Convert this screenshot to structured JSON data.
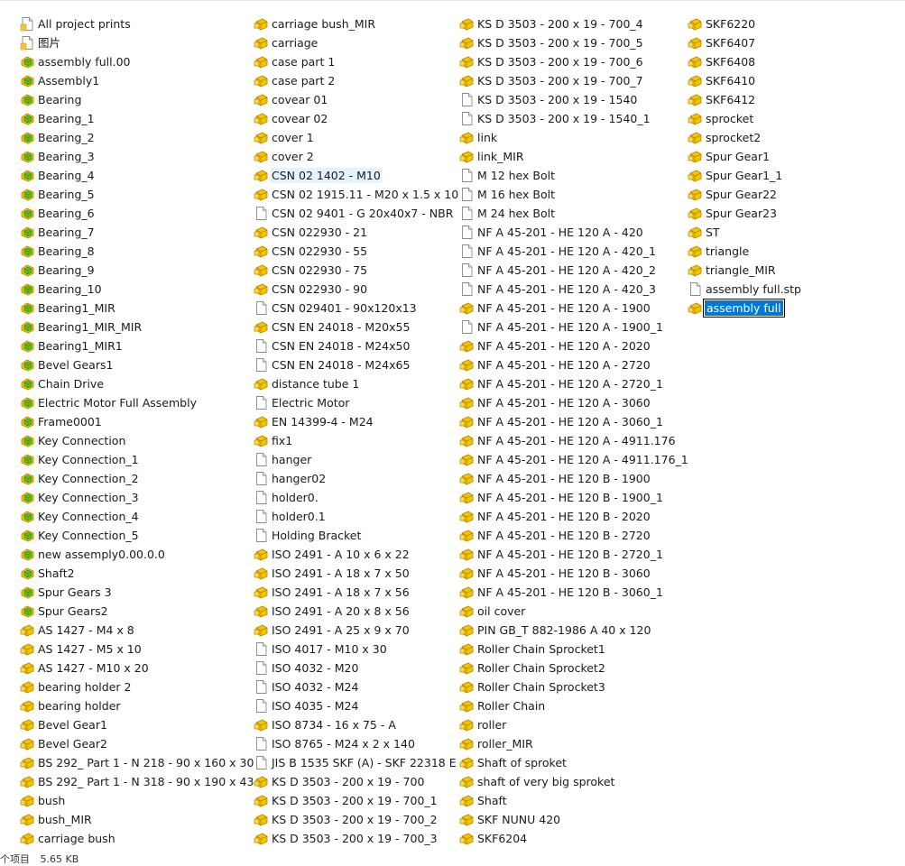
{
  "colors": {
    "selection": "#cce8ff",
    "rename_highlight": "#0078d7",
    "assembly_icon_yellow": "#f5c400",
    "part_icon_green": "#5fbf2a",
    "file_icon_border": "#8a8a8a"
  },
  "columns": [
    {
      "items": [
        {
          "name": "All project prints",
          "icon": "folder-doc"
        },
        {
          "name": "图片",
          "icon": "folder-doc"
        },
        {
          "name": "assembly full.00",
          "icon": "part"
        },
        {
          "name": "Assembly1",
          "icon": "part"
        },
        {
          "name": "Bearing",
          "icon": "part"
        },
        {
          "name": "Bearing_1",
          "icon": "part"
        },
        {
          "name": "Bearing_2",
          "icon": "part"
        },
        {
          "name": "Bearing_3",
          "icon": "part"
        },
        {
          "name": "Bearing_4",
          "icon": "part"
        },
        {
          "name": "Bearing_5",
          "icon": "part"
        },
        {
          "name": "Bearing_6",
          "icon": "part"
        },
        {
          "name": "Bearing_7",
          "icon": "part"
        },
        {
          "name": "Bearing_8",
          "icon": "part"
        },
        {
          "name": "Bearing_9",
          "icon": "part"
        },
        {
          "name": "Bearing_10",
          "icon": "part"
        },
        {
          "name": "Bearing1_MIR",
          "icon": "part"
        },
        {
          "name": "Bearing1_MIR_MIR",
          "icon": "part"
        },
        {
          "name": "Bearing1_MIR1",
          "icon": "part"
        },
        {
          "name": "Bevel Gears1",
          "icon": "part"
        },
        {
          "name": "Chain Drive",
          "icon": "part"
        },
        {
          "name": "Electric  Motor Full Assembly",
          "icon": "part"
        },
        {
          "name": "Frame0001",
          "icon": "part"
        },
        {
          "name": "Key Connection",
          "icon": "part"
        },
        {
          "name": "Key Connection_1",
          "icon": "part"
        },
        {
          "name": "Key Connection_2",
          "icon": "part"
        },
        {
          "name": "Key Connection_3",
          "icon": "part"
        },
        {
          "name": "Key Connection_4",
          "icon": "part"
        },
        {
          "name": "Key Connection_5",
          "icon": "part"
        },
        {
          "name": "new assemply0.00.0.0",
          "icon": "part"
        },
        {
          "name": "Shaft2",
          "icon": "part"
        },
        {
          "name": "Spur Gears 3",
          "icon": "part"
        },
        {
          "name": "Spur Gears2",
          "icon": "part"
        },
        {
          "name": "AS 1427 - M4 x 8",
          "icon": "assembly"
        },
        {
          "name": "AS 1427 - M5 x 10",
          "icon": "assembly"
        },
        {
          "name": "AS 1427 - M10 x 20",
          "icon": "assembly"
        },
        {
          "name": "bearing holder 2",
          "icon": "assembly"
        },
        {
          "name": "bearing holder",
          "icon": "assembly"
        },
        {
          "name": "Bevel Gear1",
          "icon": "assembly"
        },
        {
          "name": "Bevel Gear2",
          "icon": "assembly"
        },
        {
          "name": "BS 292_ Part 1 - N 218 - 90 x 160 x 30",
          "icon": "assembly"
        },
        {
          "name": "BS 292_ Part 1 - N 318 - 90 x 190 x 43",
          "icon": "assembly"
        },
        {
          "name": "bush",
          "icon": "assembly"
        },
        {
          "name": "bush_MIR",
          "icon": "assembly"
        },
        {
          "name": "carriage bush",
          "icon": "assembly"
        }
      ]
    },
    {
      "items": [
        {
          "name": "carriage bush_MIR",
          "icon": "assembly"
        },
        {
          "name": "carriage",
          "icon": "assembly"
        },
        {
          "name": "case part 1",
          "icon": "assembly"
        },
        {
          "name": "case part 2",
          "icon": "assembly"
        },
        {
          "name": "covear 01",
          "icon": "assembly"
        },
        {
          "name": "covear 02",
          "icon": "assembly"
        },
        {
          "name": "cover 1",
          "icon": "assembly"
        },
        {
          "name": "cover 2",
          "icon": "assembly"
        },
        {
          "name": "CSN 02 1402 - M10",
          "icon": "assembly",
          "state": "hover"
        },
        {
          "name": "CSN 02 1915.11 - M20 x 1.5 x 10",
          "icon": "assembly"
        },
        {
          "name": "CSN 02 9401 - G 20x40x7 - NBR",
          "icon": "blank"
        },
        {
          "name": "CSN 022930 - 21",
          "icon": "assembly"
        },
        {
          "name": "CSN 022930 - 55",
          "icon": "assembly"
        },
        {
          "name": "CSN 022930 - 75",
          "icon": "assembly"
        },
        {
          "name": "CSN 022930 - 90",
          "icon": "assembly"
        },
        {
          "name": "CSN 029401 - 90x120x13",
          "icon": "blank"
        },
        {
          "name": "CSN EN 24018 - M20x55",
          "icon": "assembly"
        },
        {
          "name": "CSN EN 24018 - M24x50",
          "icon": "blank"
        },
        {
          "name": "CSN EN 24018 - M24x65",
          "icon": "blank"
        },
        {
          "name": "distance tube 1",
          "icon": "assembly"
        },
        {
          "name": "Electric Motor",
          "icon": "blank"
        },
        {
          "name": "EN 14399-4 - M24",
          "icon": "assembly"
        },
        {
          "name": "fix1",
          "icon": "assembly"
        },
        {
          "name": "hanger",
          "icon": "blank"
        },
        {
          "name": "hanger02",
          "icon": "blank"
        },
        {
          "name": "holder0.",
          "icon": "blank"
        },
        {
          "name": "holder0.1",
          "icon": "blank"
        },
        {
          "name": "Holding Bracket",
          "icon": "blank"
        },
        {
          "name": "ISO 2491 - A  10 x 6 x 22",
          "icon": "assembly"
        },
        {
          "name": "ISO 2491 - A  18 x 7 x 50",
          "icon": "assembly"
        },
        {
          "name": "ISO 2491 - A  18 x 7 x 56",
          "icon": "assembly"
        },
        {
          "name": "ISO 2491 - A  20 x 8 x 56",
          "icon": "assembly"
        },
        {
          "name": "ISO 2491 - A  25 x 9 x 70",
          "icon": "assembly"
        },
        {
          "name": "ISO 4017 - M10 x 30",
          "icon": "blank"
        },
        {
          "name": "ISO 4032 - M20",
          "icon": "blank"
        },
        {
          "name": "ISO 4032 - M24",
          "icon": "blank"
        },
        {
          "name": "ISO 4035 - M24",
          "icon": "blank"
        },
        {
          "name": "ISO 8734 - 16 x 75 - A",
          "icon": "assembly"
        },
        {
          "name": "ISO 8765 - M24 x 2 x 140",
          "icon": "blank"
        },
        {
          "name": "JIS B 1535 SKF (A) - SKF 22318 E",
          "icon": "blank"
        },
        {
          "name": "KS D 3503 - 200 x 19 - 700",
          "icon": "assembly"
        },
        {
          "name": "KS D 3503 - 200 x 19 - 700_1",
          "icon": "assembly"
        },
        {
          "name": "KS D 3503 - 200 x 19 - 700_2",
          "icon": "assembly"
        },
        {
          "name": "KS D 3503 - 200 x 19 - 700_3",
          "icon": "assembly"
        }
      ]
    },
    {
      "items": [
        {
          "name": "KS D 3503 - 200 x 19 - 700_4",
          "icon": "assembly"
        },
        {
          "name": "KS D 3503 - 200 x 19 - 700_5",
          "icon": "assembly"
        },
        {
          "name": "KS D 3503 - 200 x 19 - 700_6",
          "icon": "assembly"
        },
        {
          "name": "KS D 3503 - 200 x 19 - 700_7",
          "icon": "assembly"
        },
        {
          "name": "KS D 3503 - 200 x 19 - 1540",
          "icon": "blank"
        },
        {
          "name": "KS D 3503 - 200 x 19 - 1540_1",
          "icon": "blank"
        },
        {
          "name": "link",
          "icon": "assembly"
        },
        {
          "name": "link_MIR",
          "icon": "assembly"
        },
        {
          "name": "M 12 hex Bolt",
          "icon": "blank"
        },
        {
          "name": "M 16 hex Bolt",
          "icon": "blank"
        },
        {
          "name": "M 24 hex Bolt",
          "icon": "blank"
        },
        {
          "name": "NF A 45-201 - HE 120 A - 420",
          "icon": "blank"
        },
        {
          "name": "NF A 45-201 - HE 120 A - 420_1",
          "icon": "blank"
        },
        {
          "name": "NF A 45-201 - HE 120 A - 420_2",
          "icon": "blank"
        },
        {
          "name": "NF A 45-201 - HE 120 A - 420_3",
          "icon": "blank"
        },
        {
          "name": "NF A 45-201 - HE 120 A - 1900",
          "icon": "assembly"
        },
        {
          "name": "NF A 45-201 - HE 120 A - 1900_1",
          "icon": "blank"
        },
        {
          "name": "NF A 45-201 - HE 120 A - 2020",
          "icon": "assembly"
        },
        {
          "name": "NF A 45-201 - HE 120 A - 2720",
          "icon": "assembly"
        },
        {
          "name": "NF A 45-201 - HE 120 A - 2720_1",
          "icon": "assembly"
        },
        {
          "name": "NF A 45-201 - HE 120 A - 3060",
          "icon": "assembly"
        },
        {
          "name": "NF A 45-201 - HE 120 A - 3060_1",
          "icon": "assembly"
        },
        {
          "name": "NF A 45-201 - HE 120 A - 4911.176",
          "icon": "assembly"
        },
        {
          "name": "NF A 45-201 - HE 120 A - 4911.176_1",
          "icon": "assembly"
        },
        {
          "name": "NF A 45-201 - HE 120 B - 1900",
          "icon": "assembly"
        },
        {
          "name": "NF A 45-201 - HE 120 B - 1900_1",
          "icon": "assembly"
        },
        {
          "name": "NF A 45-201 - HE 120 B - 2020",
          "icon": "assembly"
        },
        {
          "name": "NF A 45-201 - HE 120 B - 2720",
          "icon": "assembly"
        },
        {
          "name": "NF A 45-201 - HE 120 B - 2720_1",
          "icon": "assembly"
        },
        {
          "name": "NF A 45-201 - HE 120 B - 3060",
          "icon": "assembly"
        },
        {
          "name": "NF A 45-201 - HE 120 B - 3060_1",
          "icon": "assembly"
        },
        {
          "name": "oil cover",
          "icon": "assembly"
        },
        {
          "name": "PIN GB_T 882-1986 A 40 x 120",
          "icon": "assembly"
        },
        {
          "name": "Roller Chain Sprocket1",
          "icon": "assembly"
        },
        {
          "name": "Roller Chain Sprocket2",
          "icon": "assembly"
        },
        {
          "name": "Roller Chain Sprocket3",
          "icon": "assembly"
        },
        {
          "name": "Roller Chain",
          "icon": "assembly"
        },
        {
          "name": "roller",
          "icon": "assembly"
        },
        {
          "name": "roller_MIR",
          "icon": "assembly"
        },
        {
          "name": "Shaft of sproket",
          "icon": "assembly"
        },
        {
          "name": "shaft of very big sproket",
          "icon": "assembly"
        },
        {
          "name": "Shaft",
          "icon": "assembly"
        },
        {
          "name": "SKF NUNU 420",
          "icon": "assembly"
        },
        {
          "name": "SKF6204",
          "icon": "assembly"
        }
      ]
    },
    {
      "items": [
        {
          "name": "SKF6220",
          "icon": "assembly"
        },
        {
          "name": "SKF6407",
          "icon": "assembly"
        },
        {
          "name": "SKF6408",
          "icon": "assembly"
        },
        {
          "name": "SKF6410",
          "icon": "assembly"
        },
        {
          "name": "SKF6412",
          "icon": "assembly"
        },
        {
          "name": "sprocket",
          "icon": "assembly"
        },
        {
          "name": "sprocket2",
          "icon": "assembly"
        },
        {
          "name": "Spur Gear1",
          "icon": "assembly"
        },
        {
          "name": "Spur Gear1_1",
          "icon": "assembly"
        },
        {
          "name": "Spur Gear22",
          "icon": "assembly"
        },
        {
          "name": "Spur Gear23",
          "icon": "assembly"
        },
        {
          "name": "ST",
          "icon": "assembly"
        },
        {
          "name": "triangle",
          "icon": "assembly"
        },
        {
          "name": "triangle_MIR",
          "icon": "assembly"
        },
        {
          "name": "assembly full.stp",
          "icon": "blank"
        },
        {
          "name": "assembly full",
          "icon": "assembly",
          "state": "renaming"
        }
      ]
    }
  ],
  "statusbar": {
    "item_text": "个项目",
    "size_text": "5.65 KB"
  }
}
